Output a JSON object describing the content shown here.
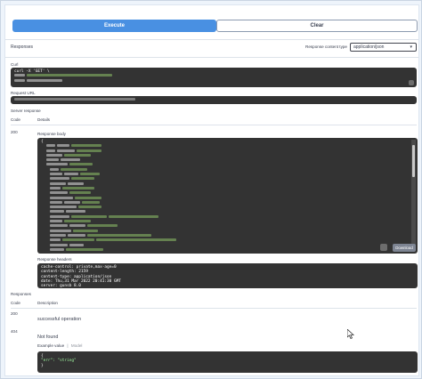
{
  "buttons": {
    "execute": "Execute",
    "clear": "Clear"
  },
  "responses_section": {
    "title": "Responses",
    "content_type_label": "Response content type",
    "content_type_value": "application/json"
  },
  "curl": {
    "label": "Curl",
    "first_line": "curl -X 'GET' \\"
  },
  "request_url": {
    "label": "Request URL"
  },
  "server_response": {
    "label": "Server response",
    "col_code": "Code",
    "col_details": "Details",
    "code": "200",
    "body_label": "Response body",
    "body_first_char": "{",
    "download_label": "Download",
    "headers_label": "Response headers",
    "headers": [
      "cache-control: private,max-age=0",
      "content-length: 2159",
      "content-type: application/json",
      "date: Thu,31 Mar 2022 20:41:30 GMT",
      "server: gunsb 8.0"
    ]
  },
  "responses_table": {
    "title": "Responses",
    "col_code": "Code",
    "col_description": "Description",
    "rows": [
      {
        "code": "200",
        "description": "successful operation"
      },
      {
        "code": "404",
        "description": "Not found"
      }
    ],
    "example_value_label": "Example value",
    "model_label": "Model",
    "example_code": [
      "{",
      "  \"err\": \"string\"",
      "}"
    ]
  },
  "colors": {
    "execute_blue": "#4990e2",
    "code_bg": "#333333",
    "blurred_green": "#6b9e4f"
  }
}
